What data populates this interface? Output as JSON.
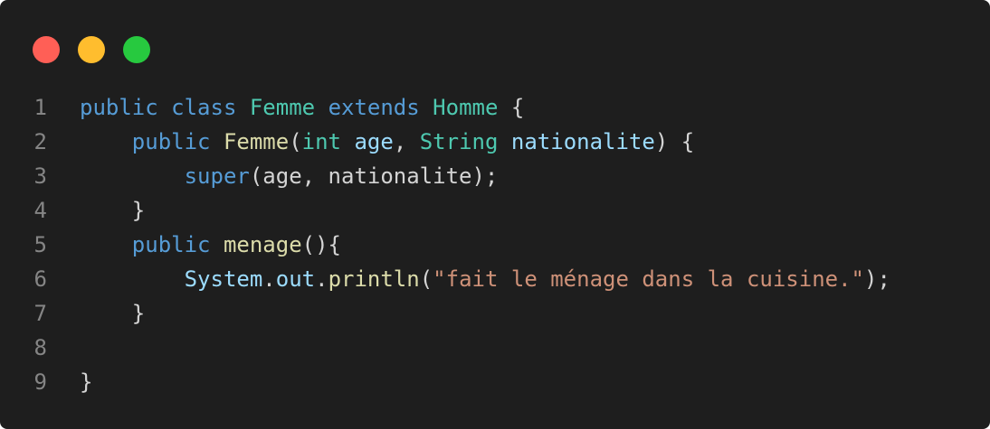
{
  "window": {
    "buttons": [
      {
        "name": "close",
        "color": "#ff5f56"
      },
      {
        "name": "minimize",
        "color": "#ffbd2e"
      },
      {
        "name": "maximize",
        "color": "#27c93f"
      }
    ]
  },
  "colors": {
    "background": "#1e1e1e",
    "keyword": "#569cd6",
    "type": "#4ec9b0",
    "function": "#dcdcaa",
    "variable": "#9cdcfe",
    "string": "#ce9178",
    "plain": "#d4d4d4",
    "line_number": "#858585"
  },
  "code": {
    "lines": [
      {
        "number": "1",
        "tokens": [
          {
            "text": "public",
            "kind": "keyword"
          },
          {
            "text": " ",
            "kind": "plain"
          },
          {
            "text": "class",
            "kind": "keyword"
          },
          {
            "text": " ",
            "kind": "plain"
          },
          {
            "text": "Femme",
            "kind": "type"
          },
          {
            "text": " ",
            "kind": "plain"
          },
          {
            "text": "extends",
            "kind": "keyword"
          },
          {
            "text": " ",
            "kind": "plain"
          },
          {
            "text": "Homme",
            "kind": "type"
          },
          {
            "text": " {",
            "kind": "plain"
          }
        ]
      },
      {
        "number": "2",
        "tokens": [
          {
            "text": "    ",
            "kind": "plain"
          },
          {
            "text": "public",
            "kind": "keyword"
          },
          {
            "text": " ",
            "kind": "plain"
          },
          {
            "text": "Femme",
            "kind": "function"
          },
          {
            "text": "(",
            "kind": "plain"
          },
          {
            "text": "int",
            "kind": "type"
          },
          {
            "text": " ",
            "kind": "plain"
          },
          {
            "text": "age",
            "kind": "variable"
          },
          {
            "text": ", ",
            "kind": "plain"
          },
          {
            "text": "String",
            "kind": "type"
          },
          {
            "text": " ",
            "kind": "plain"
          },
          {
            "text": "nationalite",
            "kind": "variable"
          },
          {
            "text": ") {",
            "kind": "plain"
          }
        ]
      },
      {
        "number": "3",
        "tokens": [
          {
            "text": "        ",
            "kind": "plain"
          },
          {
            "text": "super",
            "kind": "keyword"
          },
          {
            "text": "(age, nationalite);",
            "kind": "plain"
          }
        ]
      },
      {
        "number": "4",
        "tokens": [
          {
            "text": "    }",
            "kind": "plain"
          }
        ]
      },
      {
        "number": "5",
        "tokens": [
          {
            "text": "    ",
            "kind": "plain"
          },
          {
            "text": "public",
            "kind": "keyword"
          },
          {
            "text": " ",
            "kind": "plain"
          },
          {
            "text": "menage",
            "kind": "function"
          },
          {
            "text": "(){",
            "kind": "plain"
          }
        ]
      },
      {
        "number": "6",
        "tokens": [
          {
            "text": "        ",
            "kind": "plain"
          },
          {
            "text": "System",
            "kind": "variable"
          },
          {
            "text": ".",
            "kind": "plain"
          },
          {
            "text": "out",
            "kind": "variable"
          },
          {
            "text": ".",
            "kind": "plain"
          },
          {
            "text": "println",
            "kind": "function"
          },
          {
            "text": "(",
            "kind": "plain"
          },
          {
            "text": "\"fait le ménage dans la cuisine.\"",
            "kind": "string"
          },
          {
            "text": ");",
            "kind": "plain"
          }
        ]
      },
      {
        "number": "7",
        "tokens": [
          {
            "text": "    }",
            "kind": "plain"
          }
        ]
      },
      {
        "number": "8",
        "tokens": []
      },
      {
        "number": "9",
        "tokens": [
          {
            "text": "}",
            "kind": "plain"
          }
        ]
      }
    ]
  }
}
